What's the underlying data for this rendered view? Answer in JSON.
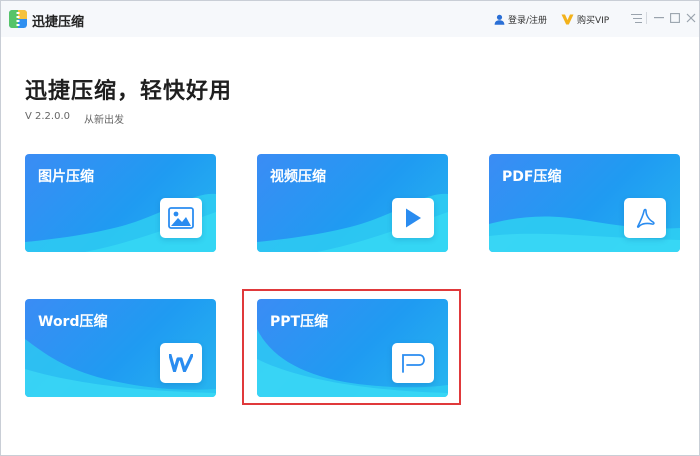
{
  "app": {
    "title": "迅捷压缩"
  },
  "header": {
    "login_label": "登录/注册",
    "vip_label": "购买VIP"
  },
  "main": {
    "headline": "迅捷压缩，轻快好用",
    "version": "V 2.2.0.0",
    "slogan": "从新出发"
  },
  "cards": [
    {
      "label": "图片压缩",
      "icon": "image-icon"
    },
    {
      "label": "视频压缩",
      "icon": "play-icon"
    },
    {
      "label": "PDF压缩",
      "icon": "pdf-icon"
    },
    {
      "label": "Word压缩",
      "icon": "word-icon"
    },
    {
      "label": "PPT压缩",
      "icon": "ppt-icon"
    }
  ],
  "colors": {
    "card_gradient_start": "#3b8cf4",
    "card_gradient_end": "#27b6ef",
    "wave_cyan": "#33d4f1",
    "accent_blue": "#2a8cf0",
    "highlight_red": "#e0393b"
  }
}
